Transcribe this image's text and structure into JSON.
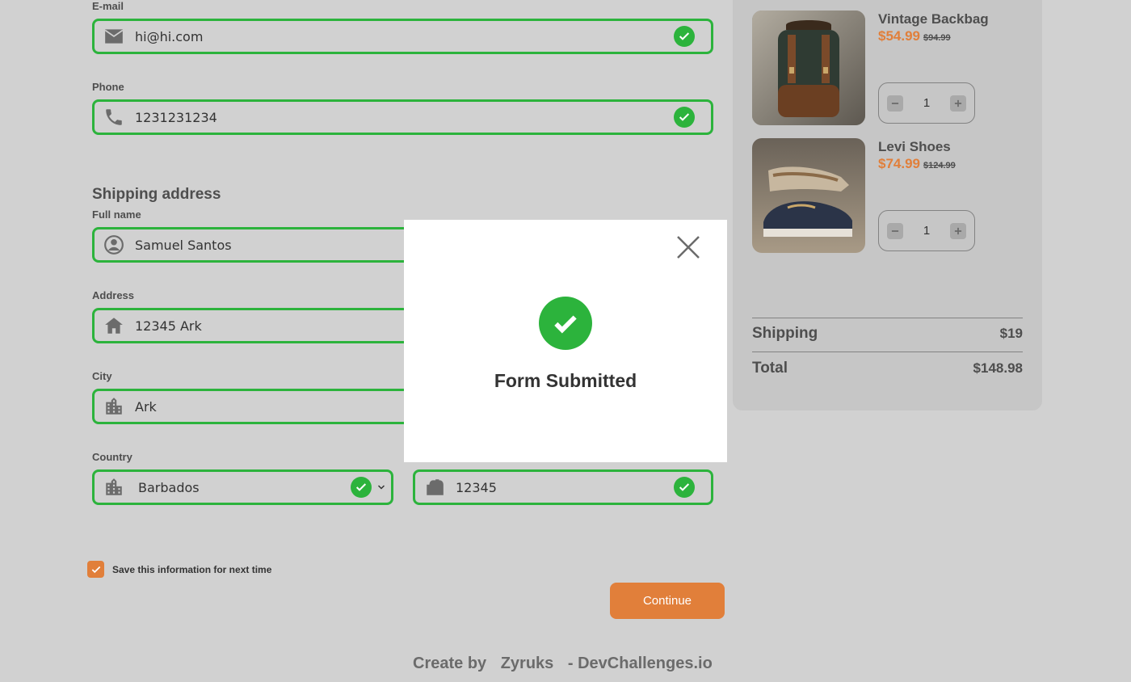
{
  "contact": {
    "email": {
      "label": "E-mail",
      "value": "hi@hi.com"
    },
    "phone": {
      "label": "Phone",
      "value": "1231231234"
    }
  },
  "shipping": {
    "title": "Shipping address",
    "full_name": {
      "label": "Full name",
      "value": "Samuel Santos"
    },
    "address": {
      "label": "Address",
      "value": "12345 Ark"
    },
    "city": {
      "label": "City",
      "value": "Ark"
    },
    "country": {
      "label": "Country",
      "value": "Barbados"
    },
    "postal_code": {
      "value": "12345"
    }
  },
  "save_info": {
    "label": "Save this information for next time",
    "checked": true
  },
  "continue_label": "Continue",
  "footer": {
    "prefix": "Create by",
    "author": "Zyruks",
    "site": "- DevChallenges.io"
  },
  "cart": {
    "items": [
      {
        "name": "Vintage Backbag",
        "price": "$54.99",
        "old_price": "$94.99",
        "qty": "1"
      },
      {
        "name": "Levi Shoes",
        "price": "$74.99",
        "old_price": "$124.99",
        "qty": "1"
      }
    ],
    "shipping_label": "Shipping",
    "shipping_value": "$19",
    "total_label": "Total",
    "total_value": "$148.98"
  },
  "modal": {
    "message": "Form Submitted"
  },
  "colors": {
    "accent": "#e17f3a",
    "success": "#2cb33c",
    "background": "#d1d1d1"
  }
}
